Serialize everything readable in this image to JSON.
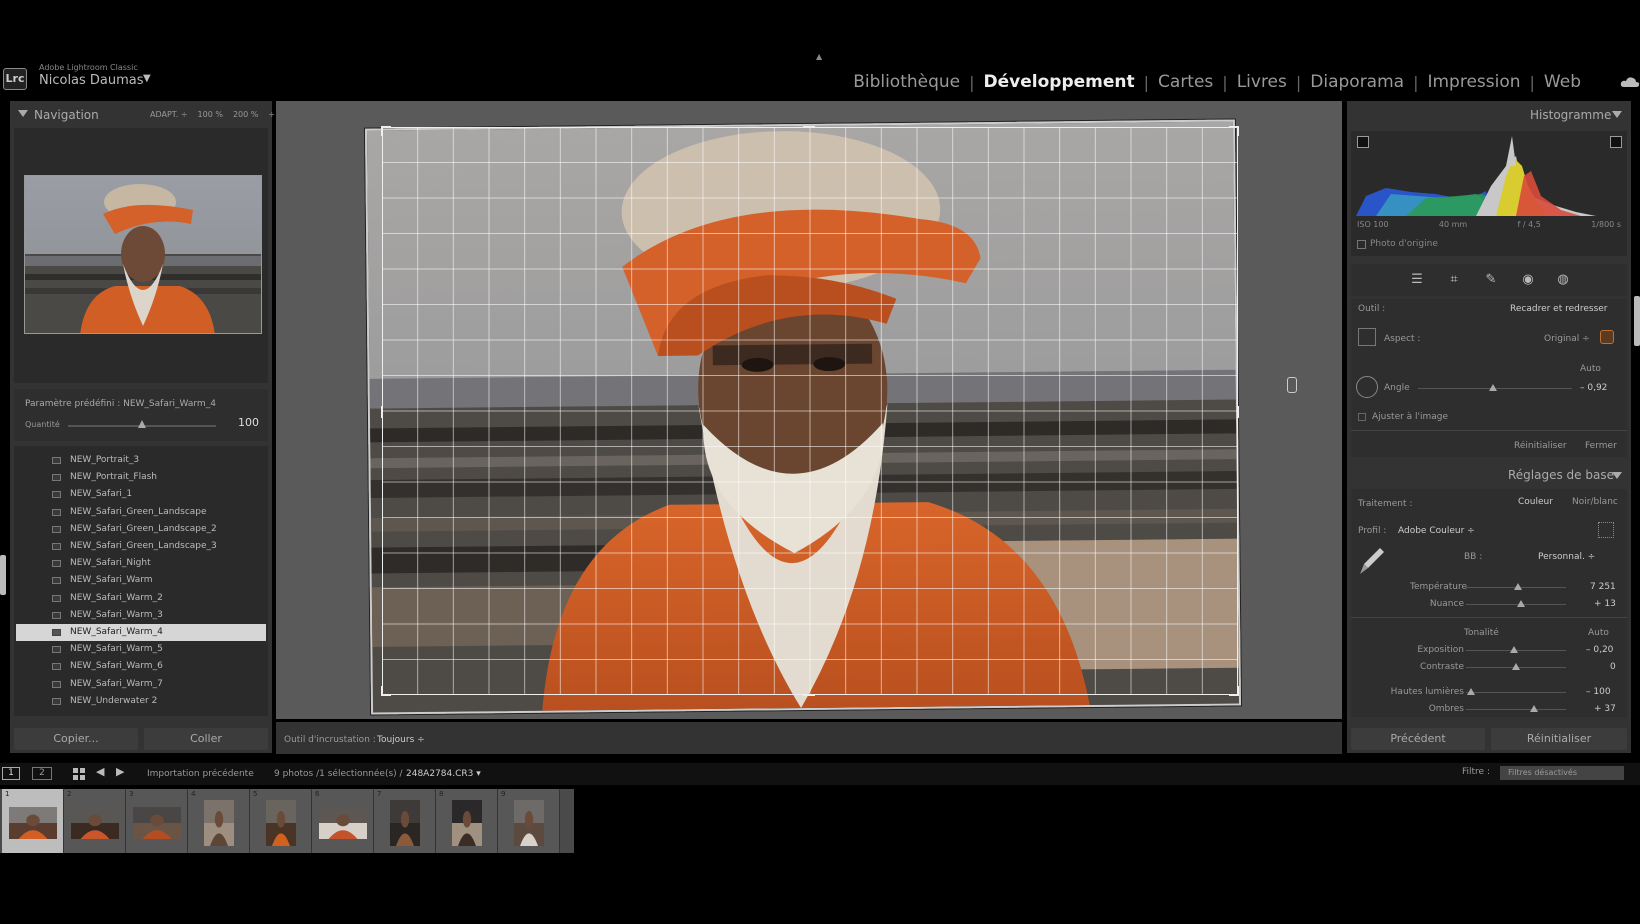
{
  "app": {
    "product": "Adobe Lightroom Classic",
    "badge": "Lrc",
    "user": "Nicolas Daumas",
    "user_caret": "▼"
  },
  "modules": [
    {
      "label": "Bibliothèque",
      "active": false
    },
    {
      "label": "Développement",
      "active": true
    },
    {
      "label": "Cartes",
      "active": false
    },
    {
      "label": "Livres",
      "active": false
    },
    {
      "label": "Diaporama",
      "active": false
    },
    {
      "label": "Impression",
      "active": false
    },
    {
      "label": "Web",
      "active": false
    }
  ],
  "navigator": {
    "title": "Navigation",
    "zoom": [
      "ADAPT. ÷",
      "100 %",
      "200 %",
      "÷"
    ]
  },
  "preset": {
    "label": "Paramètre prédéfini : NEW_Safari_Warm_4",
    "amount_label": "Quantité",
    "amount_value": "100",
    "amount": 100
  },
  "preset_list": {
    "items": [
      "NEW_Portrait_3",
      "NEW_Portrait_Flash",
      "NEW_Safari_1",
      "NEW_Safari_Green_Landscape",
      "NEW_Safari_Green_Landscape_2",
      "NEW_Safari_Green_Landscape_3",
      "NEW_Safari_Night",
      "NEW_Safari_Warm",
      "NEW_Safari_Warm_2",
      "NEW_Safari_Warm_3",
      "NEW_Safari_Warm_4",
      "NEW_Safari_Warm_5",
      "NEW_Safari_Warm_6",
      "NEW_Safari_Warm_7",
      "NEW_Underwater 2"
    ],
    "selected": "NEW_Safari_Warm_4"
  },
  "left_buttons": {
    "copy": "Copier...",
    "paste": "Coller"
  },
  "toolbar": {
    "overlay_label": "Outil d'incrustation :",
    "overlay_value": "Toujours ÷"
  },
  "histogram": {
    "title": "Histogramme",
    "exif": [
      "ISO 100",
      "40 mm",
      "f / 4,5",
      "1/800 s"
    ],
    "original_label": "Photo d'origine"
  },
  "crop": {
    "tool_label": "Outil :",
    "tool_value": "Recadrer et redresser",
    "aspect_label": "Aspect :",
    "aspect_value": "Original ÷",
    "auto": "Auto",
    "angle_label": "Angle",
    "angle_value": "– 0,92",
    "angle": -0.92,
    "constrain_label": "Ajuster à l'image",
    "reset": "Réinitialiser",
    "close": "Fermer"
  },
  "basic": {
    "title": "Réglages de base",
    "treatment_label": "Traitement :",
    "color": "Couleur",
    "bw": "Noir/blanc",
    "profile_label": "Profil :",
    "profile_value": "Adobe Couleur ÷",
    "wb_label": "BB :",
    "wb_value": "Personnal. ÷",
    "temp_label": "Température",
    "temp_value": "7 251",
    "temp_pos": 0.52,
    "tint_label": "Nuance",
    "tint_value": "+ 13",
    "tint_pos": 0.55,
    "tone_label": "Tonalité",
    "tone_auto": "Auto",
    "exposure_label": "Exposition",
    "exposure_value": "– 0,20",
    "exposure_pos": 0.48,
    "contrast_label": "Contraste",
    "contrast_value": "0",
    "contrast_pos": 0.5,
    "highlights_label": "Hautes lumières",
    "highlights_value": "– 100",
    "highlights_pos": 0.05,
    "shadows_label": "Ombres",
    "shadows_value": "+ 37",
    "shadows_pos": 0.68
  },
  "right_buttons": {
    "previous": "Précédent",
    "reset": "Réinitialiser"
  },
  "filmstrip": {
    "monitor1": "1",
    "monitor2": "2",
    "source": "Importation précédente",
    "count": "9 photos /1 sélectionnée(s) /",
    "filename": "248A2784.CR3 ▾",
    "filter_label": "Filtre :",
    "filter_value": "Filtres désactivés",
    "numbers": [
      "1",
      "2",
      "3",
      "4",
      "5",
      "6",
      "7",
      "8",
      "9"
    ],
    "selected": 1
  },
  "colors": {
    "accent_orange": "#d86a2f",
    "panel": "#333333",
    "selected_row": "#d6d6d6"
  }
}
